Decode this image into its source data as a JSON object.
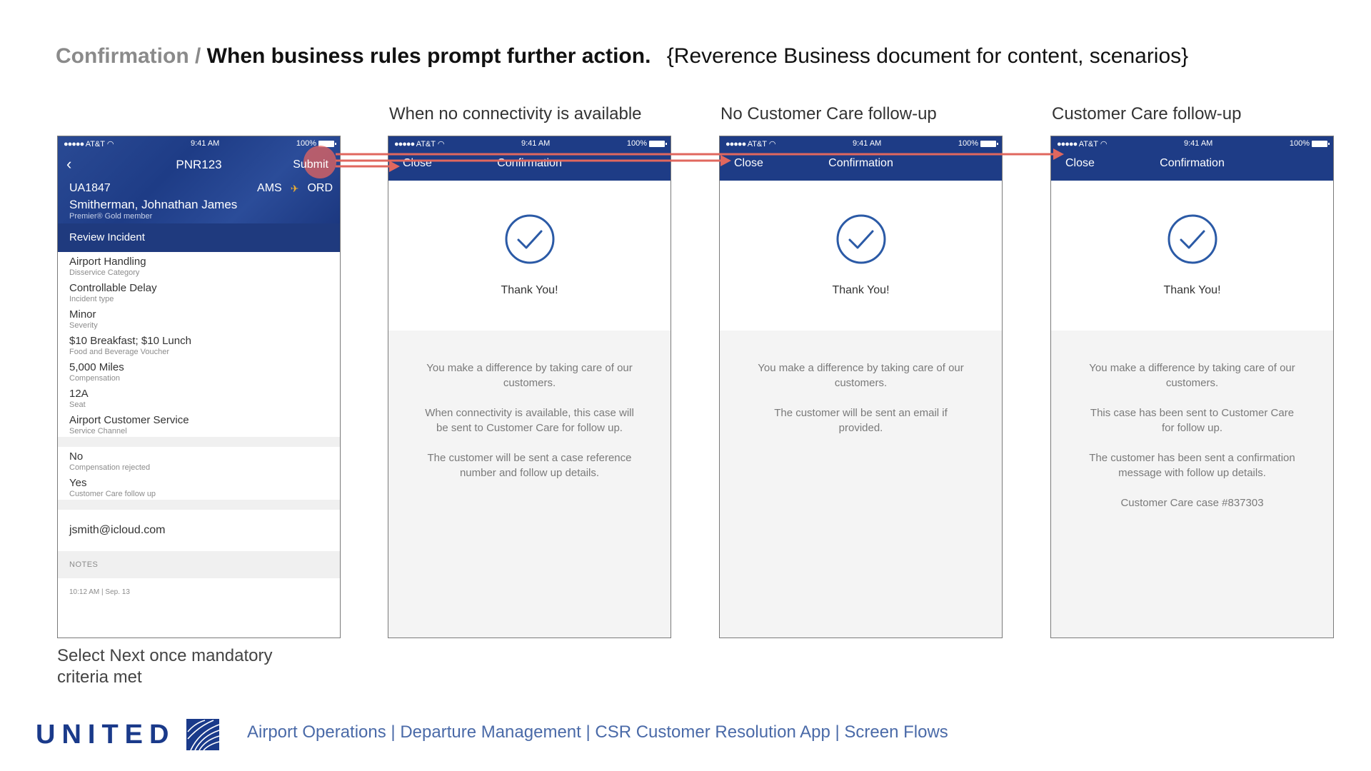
{
  "title": {
    "crumb": "Confirmation /",
    "heading": "When business rules prompt further action.",
    "note": "{Reverence Business document for content, scenarios}"
  },
  "columns": [
    {
      "label": "When no connectivity is available"
    },
    {
      "label": "No Customer Care follow-up"
    },
    {
      "label": "Customer Care follow-up"
    }
  ],
  "status_bar": {
    "carrier": "AT&T",
    "time": "9:41 AM",
    "battery": "100%"
  },
  "detail": {
    "pnr": "PNR123",
    "submit": "Submit",
    "flight": "UA1847",
    "origin": "AMS",
    "destination": "ORD",
    "passenger": "Smitherman, Johnathan James",
    "membership": "Premier® Gold member",
    "section": "Review Incident",
    "fields": [
      {
        "value": "Airport Handling",
        "label": "Disservice Category"
      },
      {
        "value": "Controllable Delay",
        "label": "Incident type"
      },
      {
        "value": "Minor",
        "label": "Severity"
      },
      {
        "value": "$10 Breakfast; $10 Lunch",
        "label": "Food and Beverage Voucher"
      },
      {
        "value": "5,000 Miles",
        "label": "Compensation"
      },
      {
        "value": "12A",
        "label": "Seat"
      },
      {
        "value": "Airport Customer Service",
        "label": "Service Channel"
      }
    ],
    "fields2": [
      {
        "value": "No",
        "label": "Compensation rejected"
      },
      {
        "value": "Yes",
        "label": "Customer Care follow up"
      }
    ],
    "email": "jsmith@icloud.com",
    "notes": "NOTES",
    "timestamp": "10:12 AM  |  Sep. 13"
  },
  "confirm": {
    "close": "Close",
    "title": "Confirmation",
    "thanks": "Thank You!"
  },
  "screens": [
    {
      "messages": [
        "You make a difference by taking care of our customers.",
        "When connectivity is available, this case will be sent to Customer Care for follow up.",
        "The customer will be sent a case reference number and follow up details."
      ]
    },
    {
      "messages": [
        "You make a difference by taking care of our customers.",
        "The customer will be sent an email if provided."
      ]
    },
    {
      "messages": [
        "You make a difference by taking care of our customers.",
        "This case has been sent to Customer Care for follow up.",
        "The customer has been sent a confirmation message with follow up details.",
        "Customer Care case #837303"
      ]
    }
  ],
  "caption": "Select Next once mandatory criteria met",
  "footer": {
    "logo": "UNITED",
    "text": "Airport Operations | Departure Management | CSR Customer Resolution App | Screen Flows"
  },
  "colors": {
    "brand_blue": "#1e3c86",
    "arrow": "#e0675e"
  }
}
